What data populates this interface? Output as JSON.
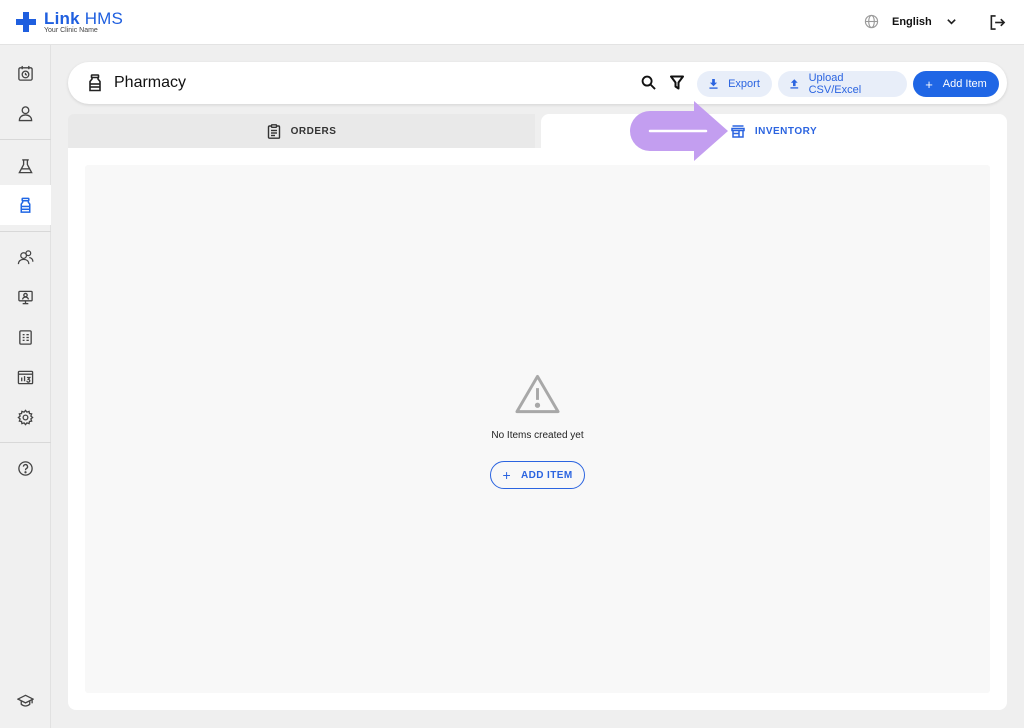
{
  "brand": {
    "name_part1": "Link",
    "name_part2": "HMS",
    "subtitle": "Your Clinic Name",
    "color": "#1f5fdf"
  },
  "topbar": {
    "language": "English",
    "icons": [
      "globe-icon",
      "chevron-down-icon",
      "logout-icon"
    ]
  },
  "sidebar": {
    "items": [
      {
        "name": "calendar-clock-icon",
        "active": false
      },
      {
        "name": "user-icon",
        "active": false
      },
      {
        "name": "lab-flask-icon",
        "active": false
      },
      {
        "name": "pharmacy-bottle-icon",
        "active": true
      },
      {
        "name": "users-icon",
        "active": false
      },
      {
        "name": "monitor-user-icon",
        "active": false
      },
      {
        "name": "report-list-icon",
        "active": false
      },
      {
        "name": "analytics-chart-icon",
        "active": false
      },
      {
        "name": "settings-gear-icon",
        "active": false
      },
      {
        "name": "help-icon",
        "active": false
      },
      {
        "name": "graduation-cap-icon",
        "active": false
      }
    ]
  },
  "header": {
    "title": "Pharmacy",
    "export_label": "Export",
    "upload_label": "Upload CSV/Excel",
    "add_label": "Add Item"
  },
  "tabs": [
    {
      "label": "ORDERS",
      "active": false
    },
    {
      "label": "INVENTORY",
      "active": true
    }
  ],
  "empty_state": {
    "message": "No Items created yet",
    "button_label": "ADD ITEM"
  },
  "colors": {
    "accent": "#1f66e5",
    "accent_light": "#e8eef9",
    "annotation_arrow": "#c39ef0"
  }
}
